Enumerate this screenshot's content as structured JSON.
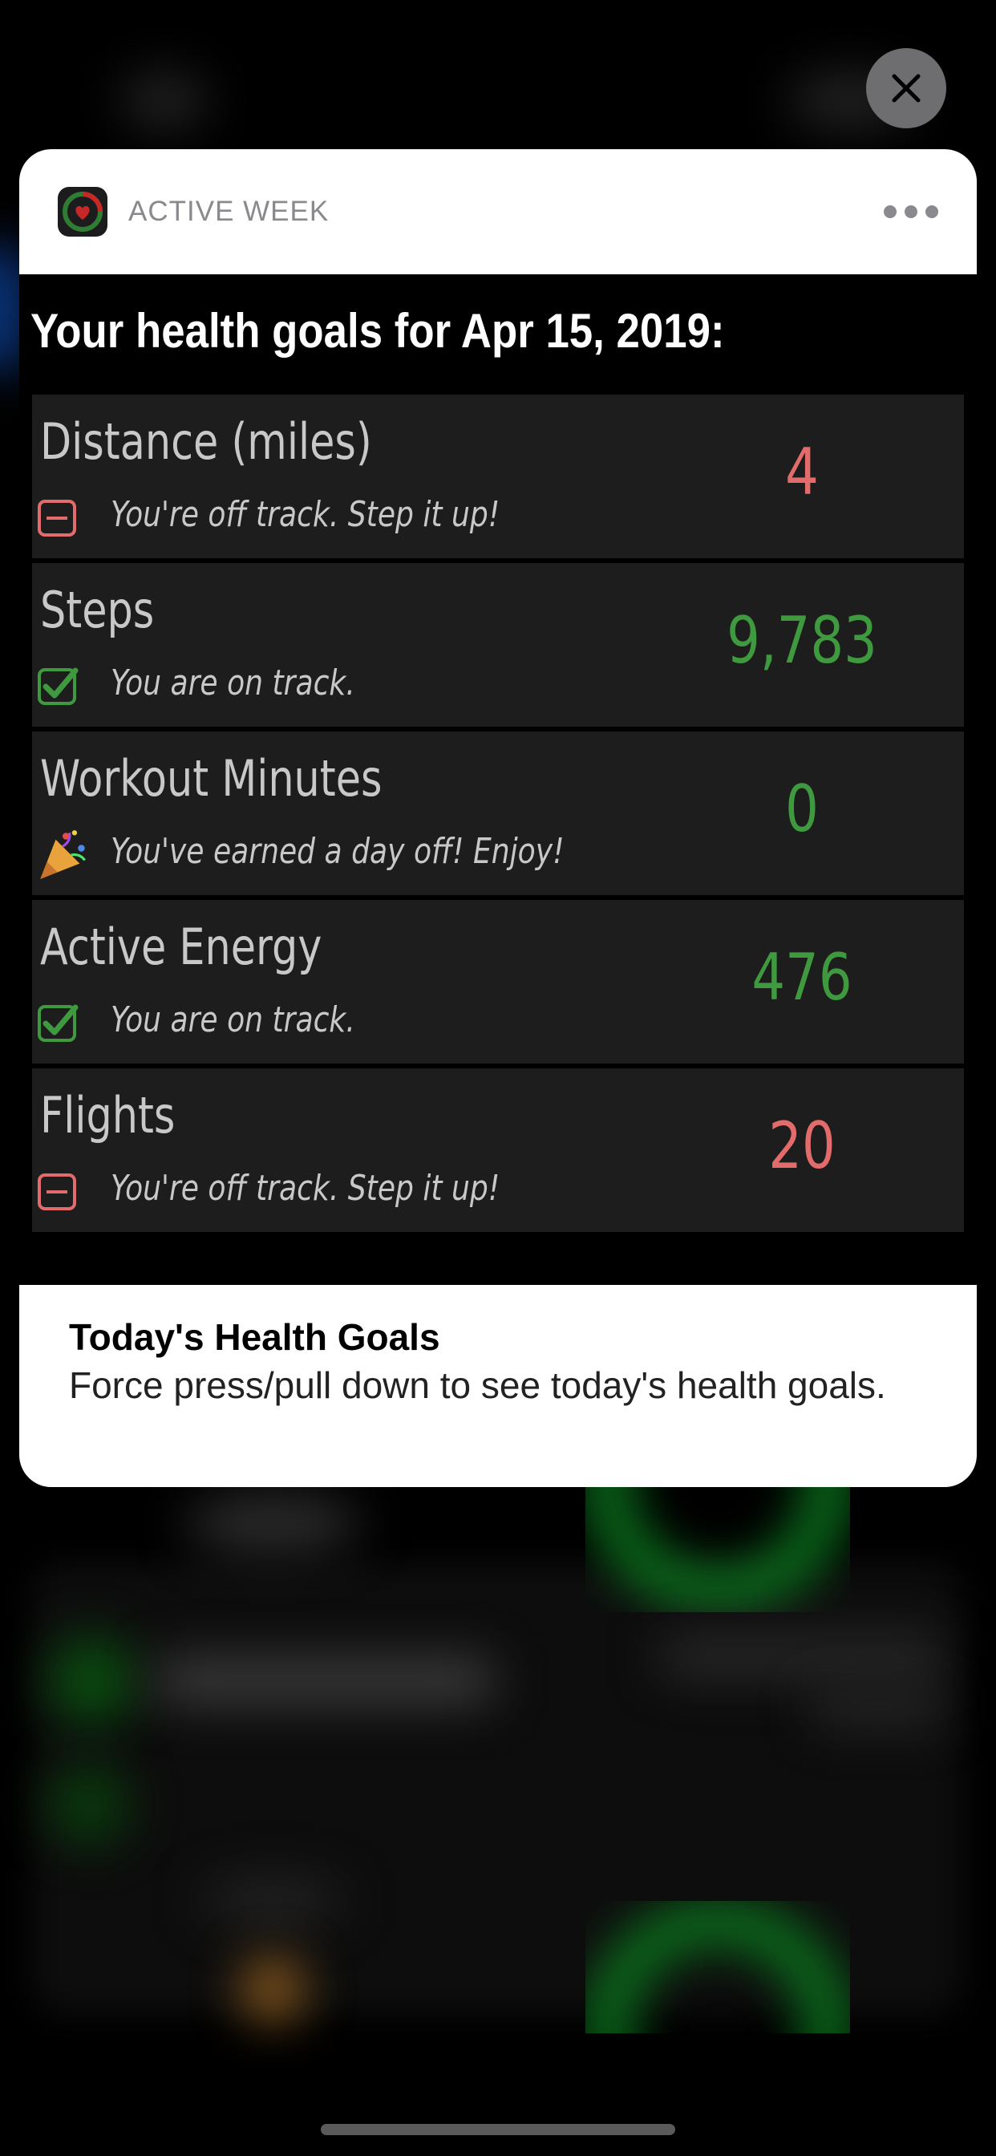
{
  "notification": {
    "app_name": "ACTIVE WEEK",
    "goals_title": "Your health goals for Apr 15, 2019:",
    "goals": [
      {
        "label": "Distance (miles)",
        "status": "You're off track.  Step it up!",
        "status_icon": "minus-square-icon",
        "value": "4",
        "value_color": "#e26b6b"
      },
      {
        "label": "Steps",
        "status": "You are on track.",
        "status_icon": "checkbox-checked-icon",
        "value": "9,783",
        "value_color": "#3f9a3f"
      },
      {
        "label": "Workout Minutes",
        "status": "You've earned a day off! Enjoy!",
        "status_icon": "party-popper-icon",
        "value": "0",
        "value_color": "#3f9a3f"
      },
      {
        "label": "Active Energy",
        "status": "You are on track.",
        "status_icon": "checkbox-checked-icon",
        "value": "476",
        "value_color": "#3f9a3f"
      },
      {
        "label": "Flights",
        "status": "You're off track.  Step it up!",
        "status_icon": "minus-square-icon",
        "value": "20",
        "value_color": "#e26b6b"
      }
    ],
    "footer": {
      "title": "Today's Health Goals",
      "body": "Force press/pull down to see today's health goals."
    }
  },
  "colors": {
    "on_track": "#3f9a3f",
    "off_track": "#e26b6b",
    "row_bg": "#1d1d1d"
  }
}
